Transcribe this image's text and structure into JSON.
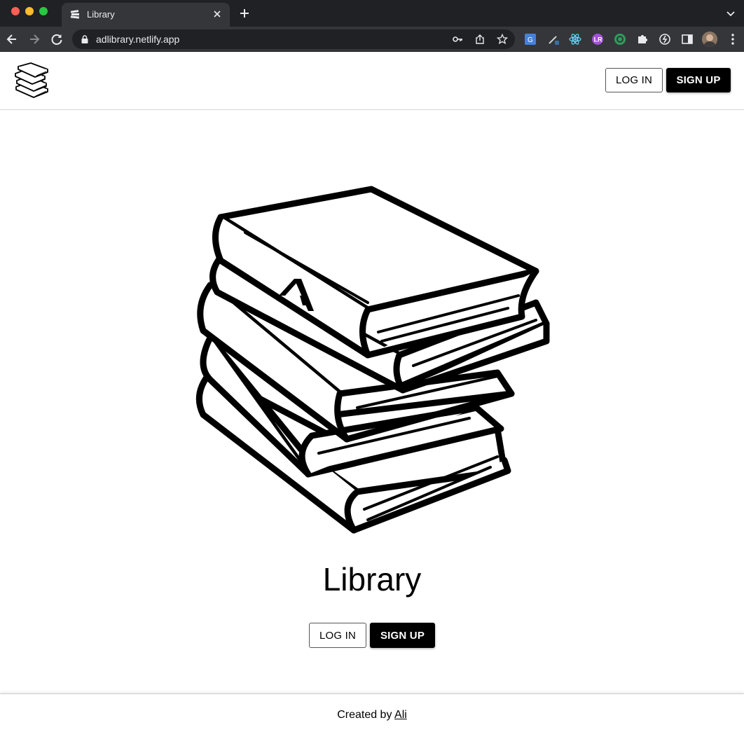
{
  "browser": {
    "tab_title": "Library",
    "url": "adlibrary.netlify.app"
  },
  "header": {
    "login_label": "LOG IN",
    "signup_label": "SIGN UP"
  },
  "hero": {
    "title": "Library",
    "login_label": "LOG IN",
    "signup_label": "SIGN UP"
  },
  "footer": {
    "prefix": "Created by ",
    "author_link": "Ali"
  },
  "icons": {
    "logo": "book-stack-icon",
    "extensions": [
      "translate-icon",
      "pen-icon",
      "react-icon",
      "lr-icon",
      "target-icon",
      "puzzle-icon",
      "sync-icon",
      "sidepanel-icon"
    ]
  },
  "colors": {
    "chrome_dark": "#202124",
    "chrome_toolbar": "#35363a",
    "brand": "#000000"
  }
}
